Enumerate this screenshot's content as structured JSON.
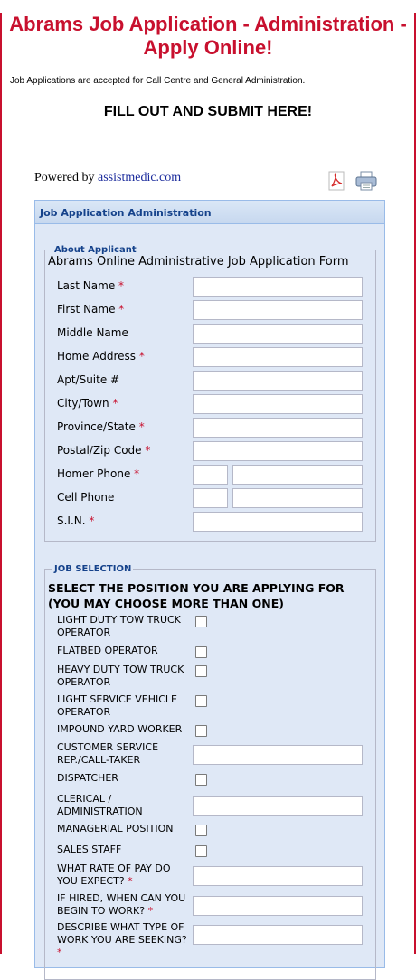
{
  "header": {
    "title": "Abrams Job Application - Administration - Apply Online!",
    "intro": "Job Applications are accepted for Call Centre and General Administration.",
    "fill_out": "FILL OUT AND SUBMIT HERE!"
  },
  "powered": {
    "prefix": "Powered by",
    "link": "assistmedic.com"
  },
  "icons": {
    "pdf": "pdf-icon",
    "print": "print-icon"
  },
  "panel": {
    "title": "Job Application Administration"
  },
  "about": {
    "legend": "About Applicant",
    "form_title": "Abrams Online Administrative Job Application Form",
    "fields": [
      {
        "label": "Last Name",
        "required": "*"
      },
      {
        "label": "First Name",
        "required": "*"
      },
      {
        "label": "Middle Name",
        "required": ""
      },
      {
        "label": "Home Address",
        "required": "*"
      },
      {
        "label": "Apt/Suite #",
        "required": ""
      },
      {
        "label": "City/Town",
        "required": "*"
      },
      {
        "label": "Province/State",
        "required": "*"
      },
      {
        "label": "Postal/Zip Code",
        "required": "*"
      },
      {
        "label": "Homer Phone",
        "required": "*"
      },
      {
        "label": "Cell Phone",
        "required": ""
      },
      {
        "label": "S.I.N.",
        "required": "*"
      }
    ]
  },
  "job": {
    "legend": "JOB SELECTION",
    "heading": "SELECT THE POSITION YOU ARE APPLYING FOR (YOU MAY CHOOSE MORE THAN ONE)",
    "items": [
      {
        "label": "LIGHT DUTY TOW TRUCK OPERATOR",
        "required": "",
        "kind": "checkbox"
      },
      {
        "label": "FLATBED OPERATOR",
        "required": "",
        "kind": "checkbox"
      },
      {
        "label": "HEAVY DUTY TOW TRUCK OPERATOR",
        "required": "",
        "kind": "checkbox"
      },
      {
        "label": "LIGHT SERVICE VEHICLE OPERATOR",
        "required": "",
        "kind": "checkbox"
      },
      {
        "label": "IMPOUND YARD WORKER",
        "required": "",
        "kind": "checkbox"
      },
      {
        "label": "CUSTOMER SERVICE REP./CALL-TAKER",
        "required": "",
        "kind": "text"
      },
      {
        "label": "DISPATCHER",
        "required": "",
        "kind": "checkbox"
      },
      {
        "label": "CLERICAL / ADMINISTRATION",
        "required": "",
        "kind": "text"
      },
      {
        "label": "MANAGERIAL POSITION",
        "required": "",
        "kind": "checkbox"
      },
      {
        "label": "SALES STAFF",
        "required": "",
        "kind": "checkbox"
      },
      {
        "label": "WHAT RATE OF PAY DO YOU EXPECT?",
        "required": "*",
        "kind": "text"
      },
      {
        "label": "IF HIRED, WHEN CAN YOU BEGIN TO WORK?",
        "required": "*",
        "kind": "text"
      },
      {
        "label": "DESCRIBE WHAT TYPE OF WORK YOU ARE SEEKING?",
        "required": "*",
        "kind": "text"
      }
    ]
  }
}
